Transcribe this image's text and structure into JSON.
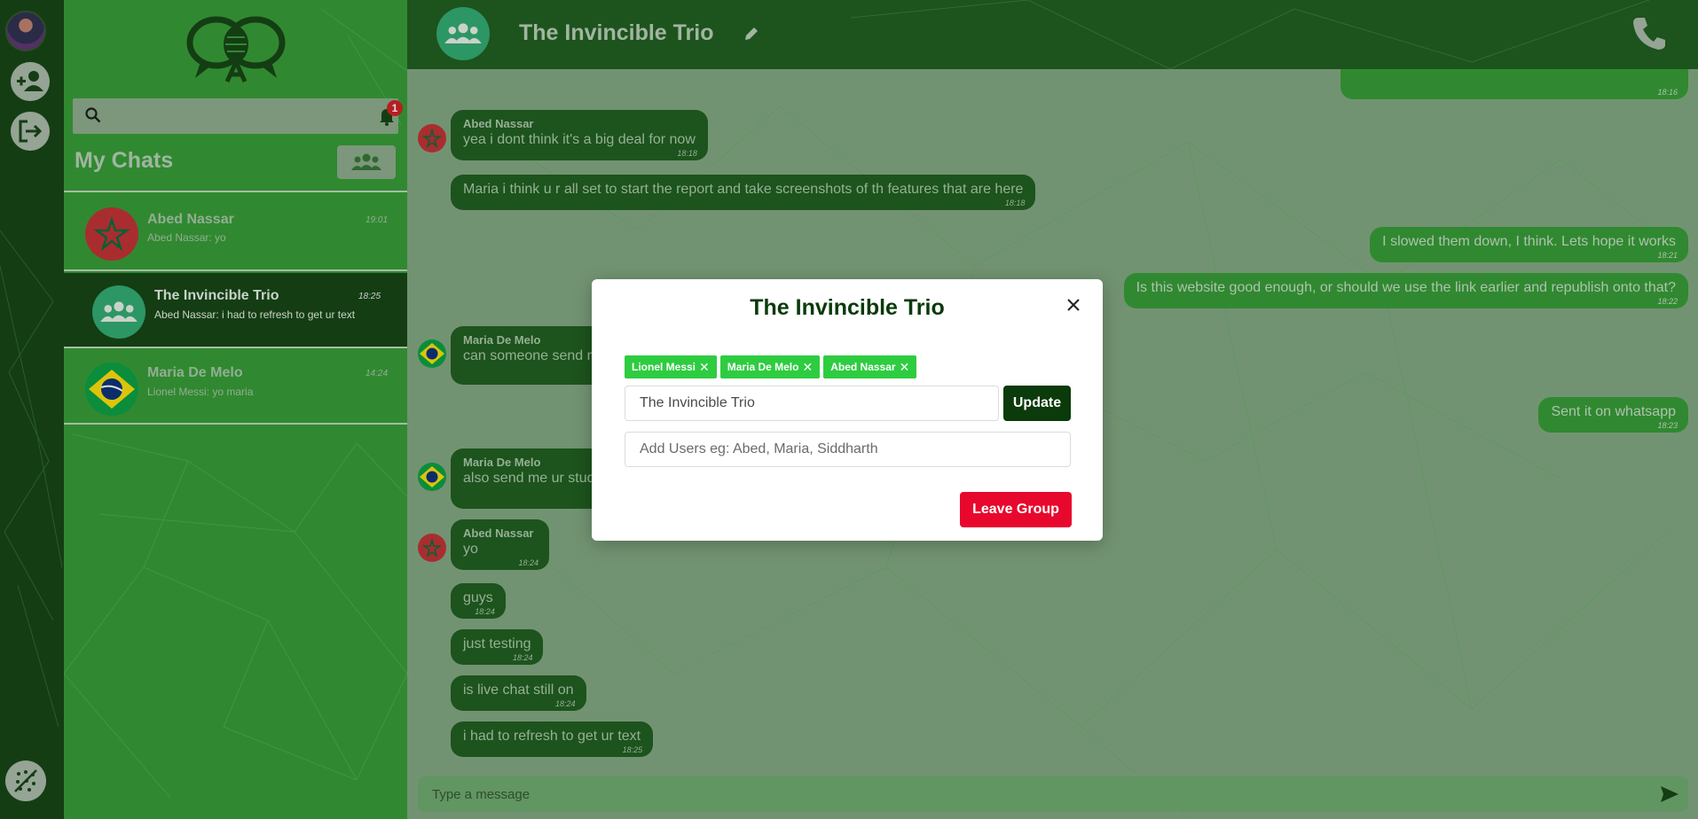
{
  "colors": {
    "accent_dark": "#0b3a0b",
    "accent": "#2e962e",
    "tag_green": "#2ecc40",
    "danger": "#e8072d"
  },
  "rail": {
    "icons": [
      "user-avatar",
      "add-user-icon",
      "logout-icon",
      "background-toggle-icon"
    ]
  },
  "sidebar": {
    "search_placeholder": "",
    "notification_count": "1",
    "title": "My Chats",
    "chats": [
      {
        "name": "Abed Nassar",
        "time": "19:01",
        "preview": "Abed Nassar: yo"
      },
      {
        "name": "The Invincible Trio",
        "time": "18:25",
        "preview": "Abed Nassar: i had to refresh to get ur text"
      },
      {
        "name": "Maria De Melo",
        "time": "14:24",
        "preview": "Lionel Messi: yo maria"
      }
    ]
  },
  "header": {
    "title": "The Invincible Trio"
  },
  "messages": [
    {
      "sender": "",
      "text": "",
      "time": "18:16"
    },
    {
      "sender": "Abed Nassar",
      "text": "yea i dont think it's a big deal for now",
      "time": "18:18"
    },
    {
      "sender": "",
      "text": "Maria i think u r all set to start the report and take screenshots of th features that are here",
      "time": "18:18"
    },
    {
      "sender": "",
      "text": "I slowed them down, I think. Lets hope it works",
      "time": "18:21"
    },
    {
      "sender": "",
      "text": "Is this website good enough, or should we use the link earlier and republish onto that?",
      "time": "18:22"
    },
    {
      "sender": "Maria De Melo",
      "text": "can someone send m",
      "time": ""
    },
    {
      "sender": "",
      "text": "Sent it on whatsapp",
      "time": "18:23"
    },
    {
      "sender": "Maria De Melo",
      "text": "also send me ur stud",
      "time": ""
    },
    {
      "sender": "Abed Nassar",
      "text": "yo",
      "time": "18:24"
    },
    {
      "sender": "",
      "text": "guys",
      "time": "18:24"
    },
    {
      "sender": "",
      "text": "just testing",
      "time": "18:24"
    },
    {
      "sender": "",
      "text": "is live chat still on",
      "time": "18:24"
    },
    {
      "sender": "",
      "text": "i had to refresh to get ur text",
      "time": "18:25"
    }
  ],
  "composer": {
    "placeholder": "Type a message"
  },
  "modal": {
    "title": "The Invincible Trio",
    "tags": [
      "Lionel Messi",
      "Maria De Melo",
      "Abed Nassar"
    ],
    "name_value": "The Invincible Trio",
    "update_label": "Update",
    "users_placeholder": "Add Users eg: Abed, Maria, Siddharth",
    "leave_label": "Leave Group"
  }
}
